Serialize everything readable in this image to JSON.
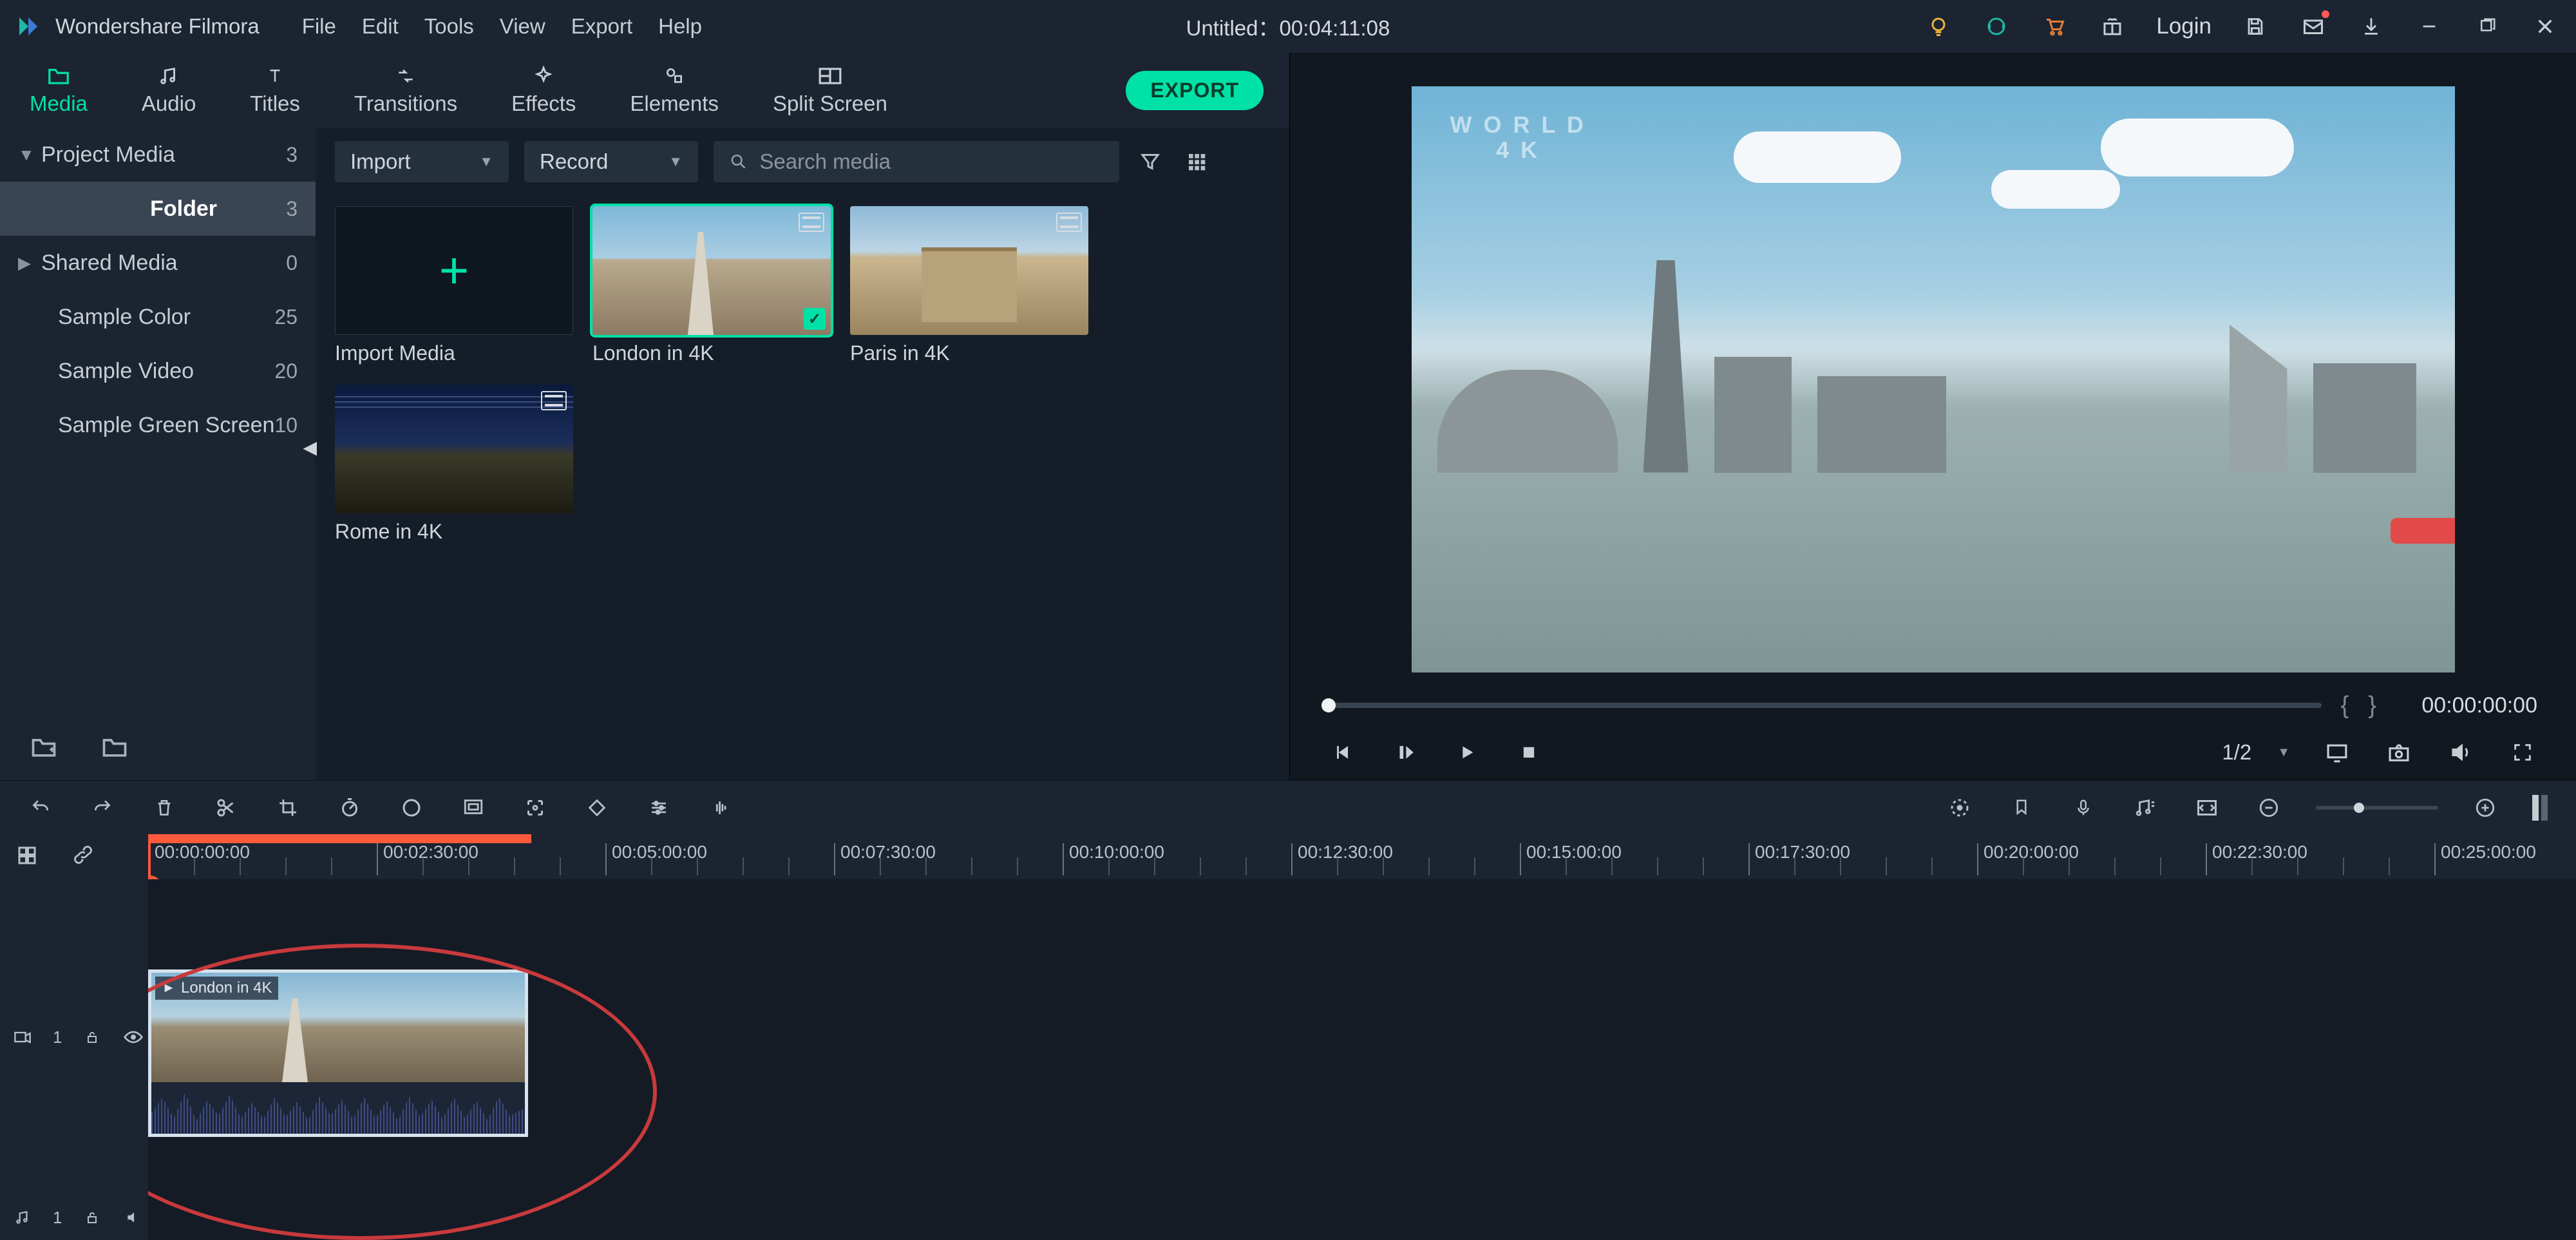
{
  "app": {
    "name": "Wondershare Filmora"
  },
  "menu": {
    "file": "File",
    "edit": "Edit",
    "tools": "Tools",
    "view": "View",
    "export": "Export",
    "help": "Help"
  },
  "title": "Untitled：00:04:11:08",
  "titlebar": {
    "login": "Login"
  },
  "tool_tabs": {
    "media": "Media",
    "audio": "Audio",
    "titles": "Titles",
    "transitions": "Transitions",
    "effects": "Effects",
    "elements": "Elements",
    "split_screen": "Split Screen",
    "export_btn": "EXPORT"
  },
  "lib_sidebar": {
    "items": [
      {
        "label": "Project Media",
        "count": "3",
        "expandable": true,
        "open": true
      },
      {
        "label": "Folder",
        "count": "3",
        "selected": true,
        "indent": true
      },
      {
        "label": "Shared Media",
        "count": "0",
        "expandable": true,
        "open": false
      },
      {
        "label": "Sample Color",
        "count": "25",
        "indent": true
      },
      {
        "label": "Sample Video",
        "count": "20",
        "indent": true
      },
      {
        "label": "Sample Green Screen",
        "count": "10",
        "indent": true
      }
    ]
  },
  "lib_toolbar": {
    "import": "Import",
    "record": "Record",
    "search_placeholder": "Search media"
  },
  "media_cards": {
    "import_tile": "Import Media",
    "london": "London in 4K",
    "paris": "Paris in 4K",
    "rome": "Rome in 4K"
  },
  "preview": {
    "watermark_line1": "W O R L D",
    "watermark_line2": "4 K",
    "time": "00:00:00:00",
    "ratio": "1/2"
  },
  "ruler": {
    "labels": [
      "00:00:00:00",
      "00:02:30:00",
      "00:05:00:00",
      "00:07:30:00",
      "00:10:00:00",
      "00:12:30:00",
      "00:15:00:00",
      "00:17:30:00",
      "00:20:00:00",
      "00:22:30:00",
      "00:25:00:00"
    ]
  },
  "track": {
    "video_id": "1",
    "audio_id": "1"
  },
  "clip": {
    "title": "London in 4K"
  }
}
